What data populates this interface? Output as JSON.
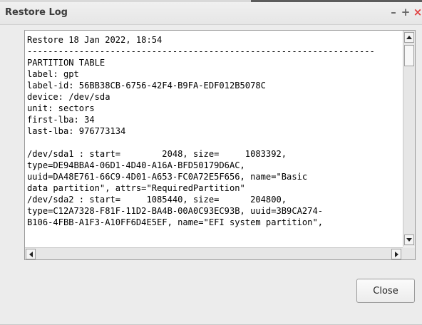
{
  "window": {
    "title": "Restore Log",
    "minimize_glyph": "–",
    "maximize_glyph": "+",
    "close_glyph": "×"
  },
  "log": {
    "lines": [
      "Restore 18 Jan 2022, 18:54",
      "-------------------------------------------------------------------",
      "PARTITION TABLE",
      "label: gpt",
      "label-id: 56BB38CB-6756-42F4-B9FA-EDF012B5078C",
      "device: /dev/sda",
      "unit: sectors",
      "first-lba: 34",
      "last-lba: 976773134",
      "",
      "/dev/sda1 : start=        2048, size=     1083392,",
      "type=DE94BBA4-06D1-4D40-A16A-BFD50179D6AC,",
      "uuid=DA48E761-66C9-4D01-A653-FC0A72E5F656, name=\"Basic",
      "data partition\", attrs=\"RequiredPartition\"",
      "/dev/sda2 : start=     1085440, size=      204800,",
      "type=C12A7328-F81F-11D2-BA4B-00A0C93EC93B, uuid=3B9CA274-",
      "B106-4FBB-A1F3-A10FF6D4E5EF, name=\"EFI system partition\","
    ]
  },
  "buttons": {
    "close_label": "Close"
  }
}
